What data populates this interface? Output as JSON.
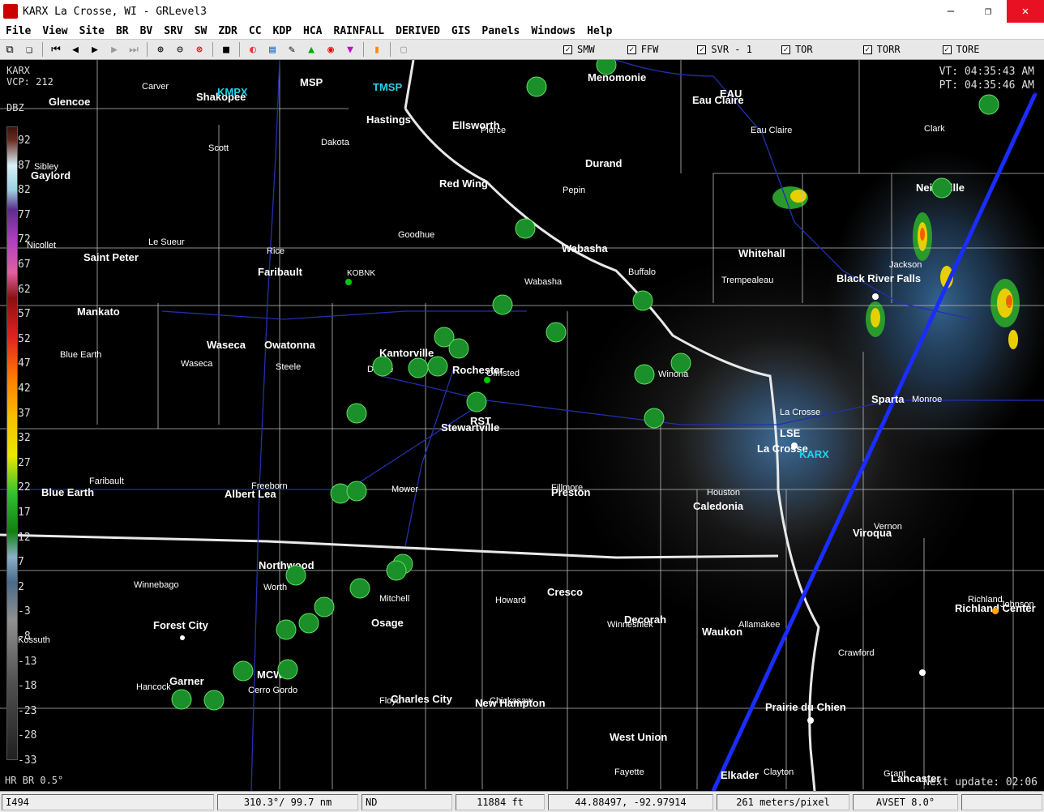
{
  "window": {
    "title": "KARX La Crosse, WI - GRLevel3",
    "controls": [
      "—",
      "❐",
      "✕"
    ]
  },
  "menu": [
    "File",
    "View",
    "Site",
    "BR",
    "BV",
    "SRV",
    "SW",
    "ZDR",
    "CC",
    "KDP",
    "HCA",
    "RAINFALL",
    "DERIVED",
    "GIS",
    "Panels",
    "Windows",
    "Help"
  ],
  "warnings": [
    {
      "label": "SMW",
      "checked": true
    },
    {
      "label": "FFW",
      "checked": true
    },
    {
      "label": "SVR - 1",
      "checked": true
    },
    {
      "label": "TOR",
      "checked": true
    },
    {
      "label": "TORR",
      "checked": true
    },
    {
      "label": "TORE",
      "checked": true
    }
  ],
  "site": {
    "id": "KARX",
    "vcp": "VCP: 212"
  },
  "times": {
    "vt": "VT: 04:35:43 AM",
    "pt": "PT: 04:35:46 AM"
  },
  "legend": {
    "unit": "DBZ",
    "ticks": [
      "92",
      "87",
      "82",
      "77",
      "72",
      "67",
      "62",
      "57",
      "52",
      "47",
      "42",
      "37",
      "32",
      "27",
      "22",
      "17",
      "12",
      "7",
      "2",
      "-3",
      "-8",
      "-13",
      "-18",
      "-23",
      "-28",
      "-33"
    ]
  },
  "product": "HR BR 0.5°",
  "next_update": "Next update: 02:06",
  "status": {
    "cell": "I494",
    "azimuth": "310.3°/ 99.7 nm",
    "nd": "ND",
    "height": "11884 ft",
    "coords": "44.88497, -92.97914",
    "resolution": "261 meters/pixel",
    "avset": "AVSET 8.0°"
  },
  "map_labels": {
    "big": [
      "Glencoe",
      "Shakopee",
      "MSP",
      "Hastings",
      "Ellsworth",
      "Menomonie",
      "EAU",
      "Eau Claire",
      "Gaylord",
      "Red Wing",
      "Durand",
      "Neillsville",
      "Saint Peter",
      "Faribault",
      "Wabasha",
      "Whitehall",
      "Black River Falls",
      "Mankato",
      "Owatonna",
      "Waseca",
      "Kantorville",
      "Rochester",
      "Sparta",
      "RST",
      "Stewartville",
      "LSE",
      "La Crosse",
      "Blue Earth",
      "Albert Lea",
      "Preston",
      "Caledonia",
      "Viroqua",
      "Northwood",
      "Cresco",
      "Osage",
      "Forest City",
      "Decorah",
      "Waukon",
      "Richland Center",
      "Garner",
      "MCW",
      "Charles City",
      "New Hampton",
      "Prairie du Chien",
      "West Union",
      "Elkader",
      "Lancaster"
    ],
    "small": [
      "Carver",
      "Scott",
      "Dakota",
      "Pierce",
      "Pepin",
      "Eau Claire",
      "Clark",
      "Sibley",
      "Nicollet",
      "Le Sueur",
      "Rice",
      "Goodhue",
      "Buffalo",
      "Trempealeau",
      "Jackson",
      "Wabasha",
      "Blue Earth",
      "Waseca",
      "Steele",
      "Dodge",
      "Olmsted",
      "Winona",
      "La Crosse",
      "Monroe",
      "Faribault",
      "Freeborn",
      "Mower",
      "Fillmore",
      "Houston",
      "Vernon",
      "Winnebago",
      "Worth",
      "Mitchell",
      "Howard",
      "Winneshiek",
      "Allamakee",
      "Crawford",
      "Kossuth",
      "Hancock",
      "Cerro Gordo",
      "Floyd",
      "Chickasaw",
      "Fayette",
      "Clayton",
      "Grant",
      "Richland",
      "Johnson",
      "KOBNK"
    ],
    "radars": [
      "KMPX",
      "TMSP",
      "KARX"
    ]
  }
}
